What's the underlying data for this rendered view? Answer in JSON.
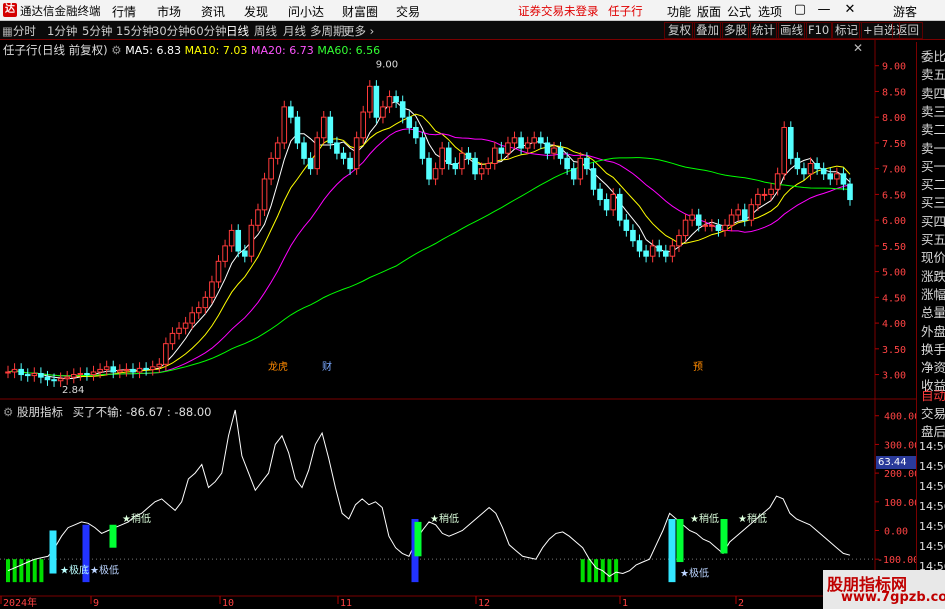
{
  "app": {
    "logo": "达",
    "title": "通达信金融终端",
    "login_status": "证券交易未登录",
    "stock_name": "任子行"
  },
  "menu": [
    "行情",
    "市场",
    "资讯",
    "发现",
    "问小达",
    "财富圈",
    "交易"
  ],
  "menu_right": [
    "功能",
    "版面",
    "公式",
    "选项",
    "游客"
  ],
  "periods": [
    "分时",
    "1分钟",
    "5分钟",
    "15分钟",
    "30分钟",
    "60分钟",
    "日线",
    "周线",
    "月线",
    "多周期",
    "更多"
  ],
  "active_period": "日线",
  "tools": [
    "复权",
    "叠加",
    "多股",
    "统计",
    "画线",
    "F10",
    "标记",
    "+自选",
    "返回"
  ],
  "main_chart": {
    "title": "任子行(日线 前复权)",
    "ma": [
      {
        "label": "MA5: 6.83",
        "color": "#ffffff"
      },
      {
        "label": "MA10: 7.03",
        "color": "#ffff00"
      },
      {
        "label": "MA20: 6.73",
        "color": "#ff00ff"
      },
      {
        "label": "MA60: 6.56",
        "color": "#00ff00"
      }
    ],
    "y_ticks": [
      "9.00",
      "8.50",
      "8.00",
      "7.50",
      "7.00",
      "6.50",
      "6.00",
      "5.50",
      "5.00",
      "4.50",
      "4.00",
      "3.50",
      "3.00"
    ],
    "high_label": "9.00",
    "low_label": "2.84",
    "event_markers": [
      "龙虎",
      "财",
      "预"
    ]
  },
  "indicator": {
    "title": "股朋指标",
    "series_label": "买了不输: -86.67",
    "value2": ": -88.00",
    "y_ticks": [
      "400.00",
      "300.00",
      "200.00",
      "100.00",
      "0.00",
      "-100.00"
    ],
    "price_tag": "63.44",
    "annotations": {
      "low": "稍低",
      "very_low": "极低",
      "bottom": "极底"
    }
  },
  "x_axis": [
    "2024年",
    "9",
    "10",
    "11",
    "12",
    "1",
    "2"
  ],
  "right_panel": {
    "items": [
      "委比",
      "卖五",
      "卖四",
      "卖三",
      "卖二",
      "卖一",
      "买一",
      "买二",
      "买三",
      "买四",
      "买五",
      "现价",
      "涨跌",
      "涨幅",
      "总量",
      "外盘",
      "换手",
      "净资",
      "收益"
    ],
    "auto": "自动",
    "after": [
      "交易",
      "盘后"
    ],
    "times": [
      "14:56",
      "14:56",
      "14:56",
      "14:56",
      "14:56",
      "14:56",
      "14:56"
    ]
  },
  "watermark": {
    "title": "股朋指标网",
    "url": "www.7gpzb.com"
  },
  "chart_data": {
    "type": "candlestick",
    "note_series": "daily close",
    "closes": [
      3.05,
      3.1,
      3.0,
      2.98,
      3.02,
      2.95,
      2.9,
      2.88,
      2.92,
      2.95,
      3.0,
      3.02,
      3.0,
      3.05,
      3.1,
      3.15,
      3.05,
      3.08,
      3.1,
      3.05,
      3.12,
      3.1,
      3.15,
      3.2,
      3.6,
      3.8,
      3.9,
      4.0,
      4.2,
      4.3,
      4.5,
      4.8,
      5.2,
      5.5,
      5.8,
      5.4,
      5.3,
      5.9,
      6.2,
      6.8,
      7.2,
      7.5,
      8.2,
      8.0,
      7.5,
      7.2,
      7.0,
      7.6,
      8.0,
      7.5,
      7.3,
      7.2,
      7.0,
      7.6,
      8.1,
      8.6,
      8.0,
      8.2,
      8.4,
      8.3,
      8.0,
      7.8,
      7.6,
      7.2,
      6.8,
      7.0,
      7.4,
      7.1,
      7.0,
      7.3,
      7.2,
      6.9,
      7.0,
      7.1,
      7.4,
      7.3,
      7.5,
      7.6,
      7.4,
      7.5,
      7.6,
      7.5,
      7.3,
      7.4,
      7.2,
      7.0,
      6.8,
      7.2,
      7.0,
      6.6,
      6.4,
      6.2,
      6.5,
      6.0,
      5.8,
      5.6,
      5.4,
      5.3,
      5.5,
      5.4,
      5.3,
      5.5,
      5.7,
      6.0,
      6.1,
      5.9,
      5.9,
      5.9,
      5.8,
      5.9,
      6.1,
      6.2,
      6.0,
      6.3,
      6.5,
      6.5,
      6.6,
      6.9,
      7.8,
      7.2,
      7.0,
      6.9,
      7.1,
      7.0,
      6.9,
      6.8,
      6.9,
      6.7,
      6.4
    ],
    "ma60_label": "MA60",
    "indicator_values": [
      -140,
      -130,
      -120,
      -110,
      -100,
      -95,
      -90,
      -60,
      -20,
      10,
      20,
      30,
      25,
      10,
      -10,
      0,
      10,
      20,
      30,
      50,
      60,
      80,
      100,
      110,
      90,
      70,
      100,
      180,
      200,
      230,
      150,
      170,
      200,
      330,
      420,
      260,
      200,
      140,
      170,
      200,
      300,
      330,
      270,
      180,
      150,
      210,
      300,
      340,
      250,
      150,
      60,
      40,
      90,
      110,
      90,
      100,
      80,
      -20,
      -60,
      -80,
      -90,
      -40,
      0,
      30,
      20,
      -10,
      -20,
      -10,
      0,
      20,
      40,
      60,
      80,
      60,
      10,
      -50,
      -70,
      -90,
      -95,
      -100,
      -60,
      -30,
      -10,
      -5,
      -20,
      -40,
      -60,
      -100,
      -130,
      -140,
      -160,
      -145,
      -150,
      -140,
      -120,
      -110,
      -100,
      -50,
      0,
      60,
      40,
      20,
      0,
      -10,
      -30,
      -40,
      -60,
      -80,
      -40,
      -20,
      0,
      20,
      40,
      60,
      80,
      120,
      110,
      60,
      40,
      30,
      20,
      0,
      -20,
      -40,
      -60,
      -80,
      -86
    ]
  }
}
